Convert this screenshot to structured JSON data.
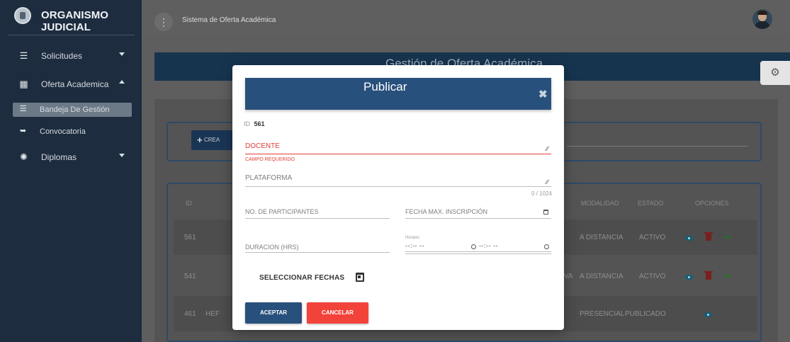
{
  "brand": {
    "title": "ORGANISMO JUDICIAL",
    "logo_icon": "seal-icon"
  },
  "sidebar": {
    "items": [
      {
        "label": "Solicitudes",
        "icon": "list-icon",
        "expanded": false
      },
      {
        "label": "Oferta Academica",
        "icon": "book-icon",
        "expanded": true
      },
      {
        "label": "Bandeja De Gestión",
        "icon": "list-icon",
        "active": true
      },
      {
        "label": "Convocatoria",
        "icon": "megaphone-icon"
      },
      {
        "label": "Diplomas",
        "icon": "badge-icon",
        "expanded": false
      }
    ]
  },
  "topbar": {
    "menu_icon": "more-vert-icon",
    "system_title": "Sistema de Oferta Académica",
    "avatar": "user-avatar"
  },
  "page": {
    "header_title": "Gestión de Oferta Académica",
    "create_label": "CREA",
    "settings_icon": "gear-icon"
  },
  "table": {
    "headers": {
      "id": "ID",
      "modalidad": "MODALIDAD",
      "estado": "ESTADO",
      "opciones": "OPCIONES"
    },
    "rows": [
      {
        "id": "561",
        "prefix": "",
        "modalidad": "A DISTANCIA",
        "estado": "ACTIVO",
        "actions": [
          "eye-icon",
          "trash-icon",
          "megaphone-icon"
        ]
      },
      {
        "id": "541",
        "prefix": "VA",
        "modalidad": "A DISTANCIA",
        "estado": "ACTIVO",
        "actions": [
          "eye-icon",
          "trash-icon",
          "megaphone-icon"
        ]
      },
      {
        "id": "461",
        "prefix": "HEF",
        "modalidad": "PRESENCIAL",
        "estado": "PUBLICADO",
        "actions": [
          "eye-icon"
        ]
      }
    ]
  },
  "modal": {
    "title": "Publicar",
    "close_icon": "close-icon",
    "id_label": "ID",
    "id_value": "561",
    "docente_label": "DOCENTE",
    "docente_error": "CAMPO REQUERIDO",
    "plataforma_label": "PLATAFORMA",
    "plataforma_counter": "0 / 1024",
    "participantes_label": "NO. DE PARTICIPANTES",
    "fecha_max_label": "FECHA MAX. INSCRIPCIÓN",
    "duracion_label": "DURACION (HRS)",
    "horario_label": "Horario",
    "horario_start": "--:-- --",
    "horario_end": "--:-- --",
    "select_dates_label": "SELECCIONAR FECHAS",
    "accept_label": "ACEPTAR",
    "cancel_label": "CANCELAR"
  },
  "colors": {
    "primary": "#28507c",
    "danger": "#f2433a",
    "sidebar": "#1d2c3f",
    "error": "#e0413a"
  }
}
